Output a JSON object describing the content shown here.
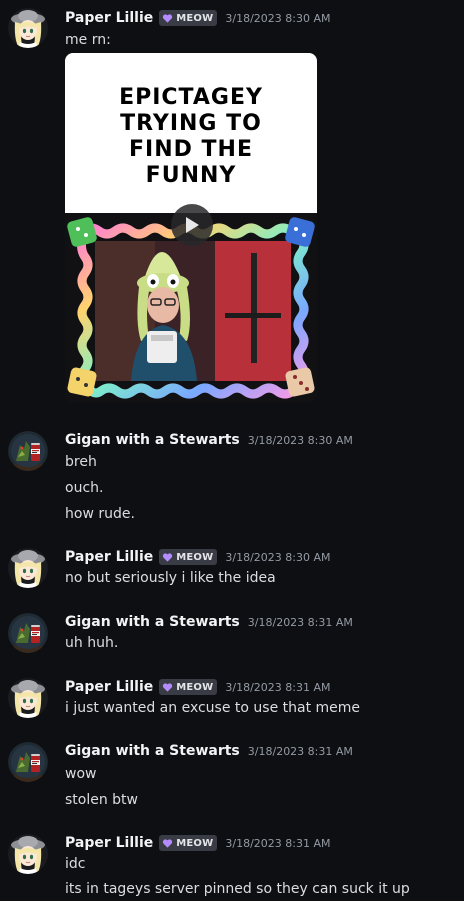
{
  "colors": {
    "background": "#0e0f12",
    "tag_bg": "#3a3c45",
    "tag_icon": "#b48cff",
    "timestamp": "#949ba4"
  },
  "messages": [
    {
      "username": "Paper Lillie",
      "tag": "MEOW",
      "tag_icon": "heart-icon",
      "timestamp": "3/18/2023 8:30 AM",
      "lines": [
        "me rn:"
      ],
      "attachment": {
        "caption": "EPICTAGEY\nTRYING TO\nFIND THE\nFUNNY",
        "type": "video"
      }
    },
    {
      "username": "Gigan with a Stewarts",
      "timestamp": "3/18/2023 8:30 AM",
      "lines": [
        "breh",
        "ouch.",
        "how rude."
      ]
    },
    {
      "username": "Paper Lillie",
      "tag": "MEOW",
      "tag_icon": "heart-icon",
      "timestamp": "3/18/2023 8:30 AM",
      "lines": [
        "no but seriously i like the idea"
      ]
    },
    {
      "username": "Gigan with a Stewarts",
      "timestamp": "3/18/2023 8:31 AM",
      "lines": [
        "uh huh."
      ]
    },
    {
      "username": "Paper Lillie",
      "tag": "MEOW",
      "tag_icon": "heart-icon",
      "timestamp": "3/18/2023 8:31 AM",
      "lines": [
        "i just wanted an excuse to use that meme"
      ]
    },
    {
      "username": "Gigan with a Stewarts",
      "timestamp": "3/18/2023 8:31 AM",
      "lines": [
        "wow",
        "stolen btw"
      ]
    },
    {
      "username": "Paper Lillie",
      "tag": "MEOW",
      "tag_icon": "heart-icon",
      "timestamp": "3/18/2023 8:31 AM",
      "lines": [
        "idc",
        "its in tageys server pinned so they can suck it up"
      ]
    }
  ]
}
